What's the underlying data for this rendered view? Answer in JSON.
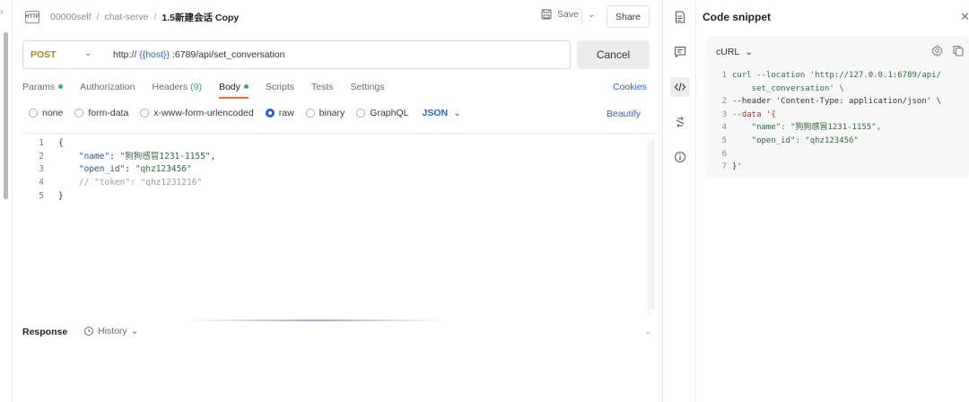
{
  "header": {
    "badge": "HTTP",
    "workspace": "00000self",
    "sep": "/",
    "collection": "chat-serve",
    "request_name": "1.5新建会话 Copy",
    "save_label": "Save",
    "share_label": "Share"
  },
  "request": {
    "method": "POST",
    "url_prefix": "http://",
    "url_var": "{{host}}",
    "url_suffix": ":6789/api/set_conversation",
    "cancel_label": "Cancel"
  },
  "tabs": [
    {
      "label": "Params",
      "dot": true
    },
    {
      "label": "Authorization"
    },
    {
      "label": "Headers",
      "count": "(9)"
    },
    {
      "label": "Body",
      "dot": true,
      "active": true
    },
    {
      "label": "Scripts"
    },
    {
      "label": "Tests"
    },
    {
      "label": "Settings"
    }
  ],
  "cookies_label": "Cookies",
  "body_types": {
    "none": "none",
    "form_data": "form-data",
    "urlencoded": "x-www-form-urlencoded",
    "raw": "raw",
    "binary": "binary",
    "graphql": "GraphQL",
    "format": "JSON",
    "selected": "raw"
  },
  "beautify_label": "Beautify",
  "editor": {
    "line_numbers": [
      "1",
      "2",
      "3",
      "4",
      "5"
    ],
    "l1": "{",
    "l2_key": "\"name\"",
    "l2_val": "\"狗狗感冒1231-1155\"",
    "l3_key": "\"open_id\"",
    "l3_val": "\"qhz123456\"",
    "l4": "// \"token\": \"qhz1231216\"",
    "l5": "}"
  },
  "response": {
    "label": "Response",
    "history_label": "History"
  },
  "sidebar_icons": [
    "document-icon",
    "comment-icon",
    "code-icon",
    "related-icon",
    "info-icon"
  ],
  "snippet": {
    "title": "Code snippet",
    "language": "cURL",
    "line_numbers": [
      "1",
      "",
      "2",
      "3",
      "4",
      "5",
      "6",
      "7"
    ],
    "lines": [
      "curl --location 'http://127.0.0.1:6789/api/",
      "    set_conversation' \\",
      "--header 'Content-Type: application/json' \\",
      "--data '{",
      "    \"name\": \"狗狗感冒1231-1155\",",
      "    \"open_id\": \"qhz123456\"",
      "",
      "}'"
    ]
  },
  "colors": {
    "accent": "#f26b3a",
    "link": "#2b64c9",
    "method": "#a88a1a",
    "dot": "#3cae67"
  }
}
